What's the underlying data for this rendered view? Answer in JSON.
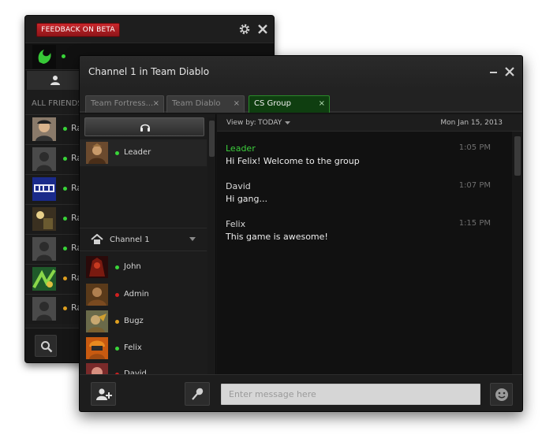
{
  "back_window": {
    "feedback_label": "FEEDBACK ON BETA",
    "section_label": "ALL FRIENDS",
    "icons": {
      "settings": "gear-icon",
      "close": "close-icon",
      "profile": "razer-logo",
      "search": "search-icon"
    },
    "friends": [
      {
        "name": "Ra",
        "status": "online",
        "status_color": "#39d539",
        "avatar": "photo"
      },
      {
        "name": "Ra",
        "status": "online",
        "status_color": "#39d539",
        "avatar": "default"
      },
      {
        "name": "Ra",
        "status": "online",
        "status_color": "#39d539",
        "avatar": "logo"
      },
      {
        "name": "Ra",
        "status": "online",
        "status_color": "#39d539",
        "avatar": "game"
      },
      {
        "name": "Ra",
        "status": "online",
        "status_color": "#39d539",
        "avatar": "default"
      },
      {
        "name": "Ra",
        "status": "away",
        "status_color": "#e0a020",
        "avatar": "art"
      },
      {
        "name": "Ra",
        "status": "away",
        "status_color": "#e0a020",
        "avatar": "default"
      }
    ]
  },
  "front_window": {
    "title": "Channel 1 in Team Diablo",
    "tabs": [
      {
        "label": "Team Fortress...",
        "close": "×",
        "active": false
      },
      {
        "label": "Team Diablo",
        "close": "×",
        "active": false
      },
      {
        "label": "CS Group",
        "close": "×",
        "active": true
      }
    ],
    "leader": {
      "name": "Leader",
      "status_color": "#39d539"
    },
    "channel": {
      "label": "Channel 1"
    },
    "members": [
      {
        "name": "John",
        "status_color": "#39d539"
      },
      {
        "name": "Admin",
        "status_color": "#d02020"
      },
      {
        "name": "Bugz",
        "status_color": "#e0a020"
      },
      {
        "name": "Felix",
        "status_color": "#39d539"
      },
      {
        "name": "David",
        "status_color": "#d02020"
      }
    ],
    "chat": {
      "view_by_label": "View by:",
      "view_by_value": "TODAY",
      "date": "Mon Jan 15, 2013",
      "messages": [
        {
          "sender": "Leader",
          "time": "1:05 PM",
          "text": "Hi Felix! Welcome to the group"
        },
        {
          "sender": "David",
          "time": "1:07 PM",
          "text": "Hi gang..."
        },
        {
          "sender": "Felix",
          "time": "1:15 PM",
          "text": "This game is awesome!"
        }
      ]
    },
    "input": {
      "placeholder": "Enter message here",
      "value": ""
    },
    "colors": {
      "accent_green": "#3ccf3c",
      "tab_active": "#0f3e10",
      "feedback_red": "#c9262b"
    }
  }
}
